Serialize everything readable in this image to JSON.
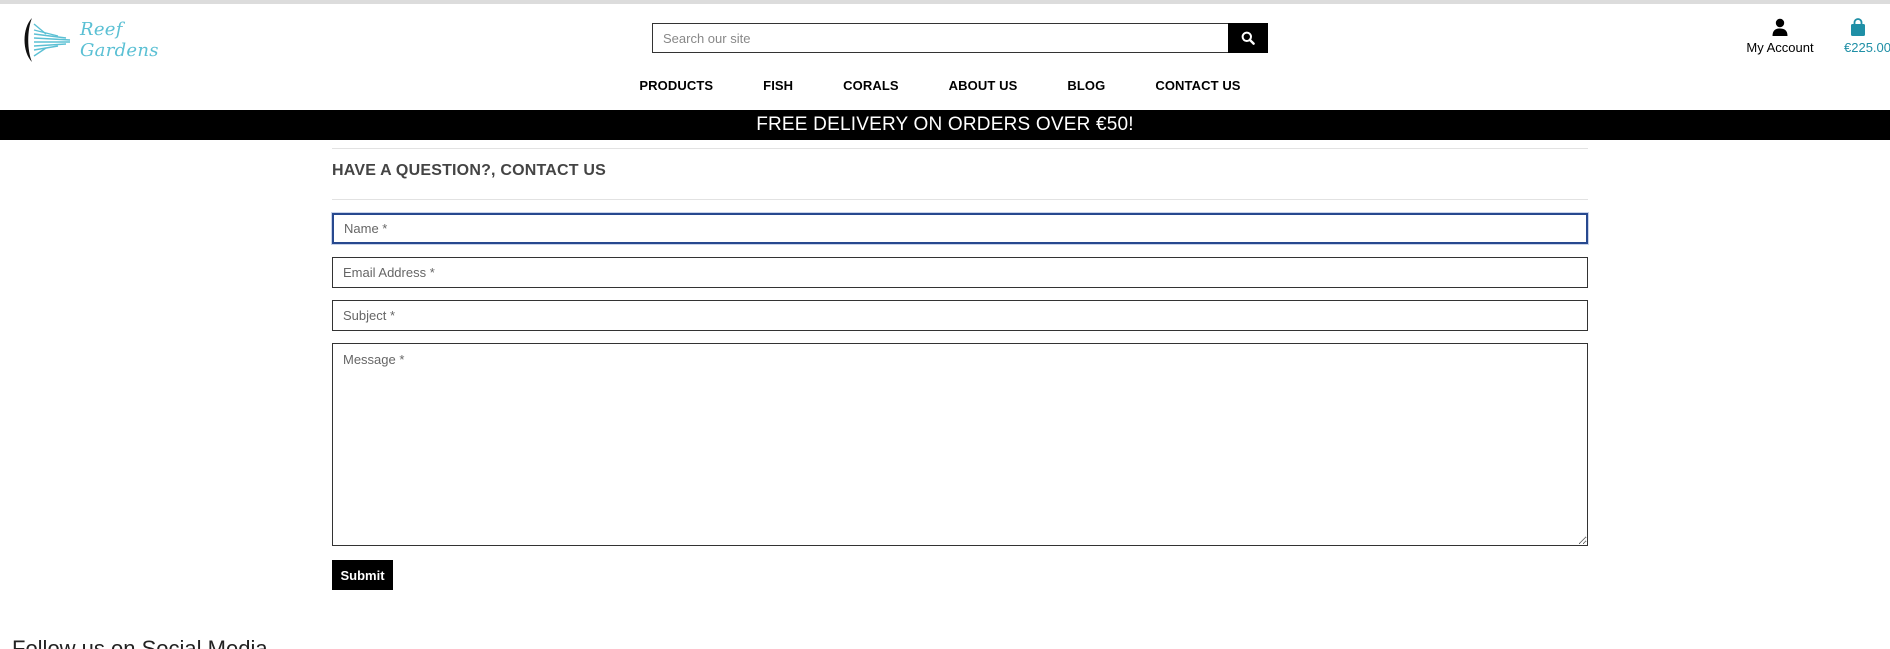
{
  "header": {
    "logo_text": "Reef Gardens",
    "search": {
      "placeholder": "Search our site",
      "button_icon": "search-icon"
    },
    "account_label": "My Account",
    "cart_total": "€225.00",
    "colors": {
      "accent": "#1f8fa6",
      "logo": "#5bc0d4"
    }
  },
  "nav": {
    "items": [
      {
        "label": "PRODUCTS"
      },
      {
        "label": "FISH"
      },
      {
        "label": "CORALS"
      },
      {
        "label": "ABOUT US"
      },
      {
        "label": "BLOG"
      },
      {
        "label": "CONTACT US"
      }
    ]
  },
  "banner": {
    "text": "FREE DELIVERY ON ORDERS OVER €50!"
  },
  "contact": {
    "heading": "HAVE A QUESTION?, CONTACT US",
    "name_placeholder": "Name *",
    "email_placeholder": "Email Address *",
    "subject_placeholder": "Subject *",
    "message_placeholder": "Message *",
    "submit_label": "Submit"
  },
  "footer": {
    "partial_heading": "Follow us on Social Media"
  }
}
